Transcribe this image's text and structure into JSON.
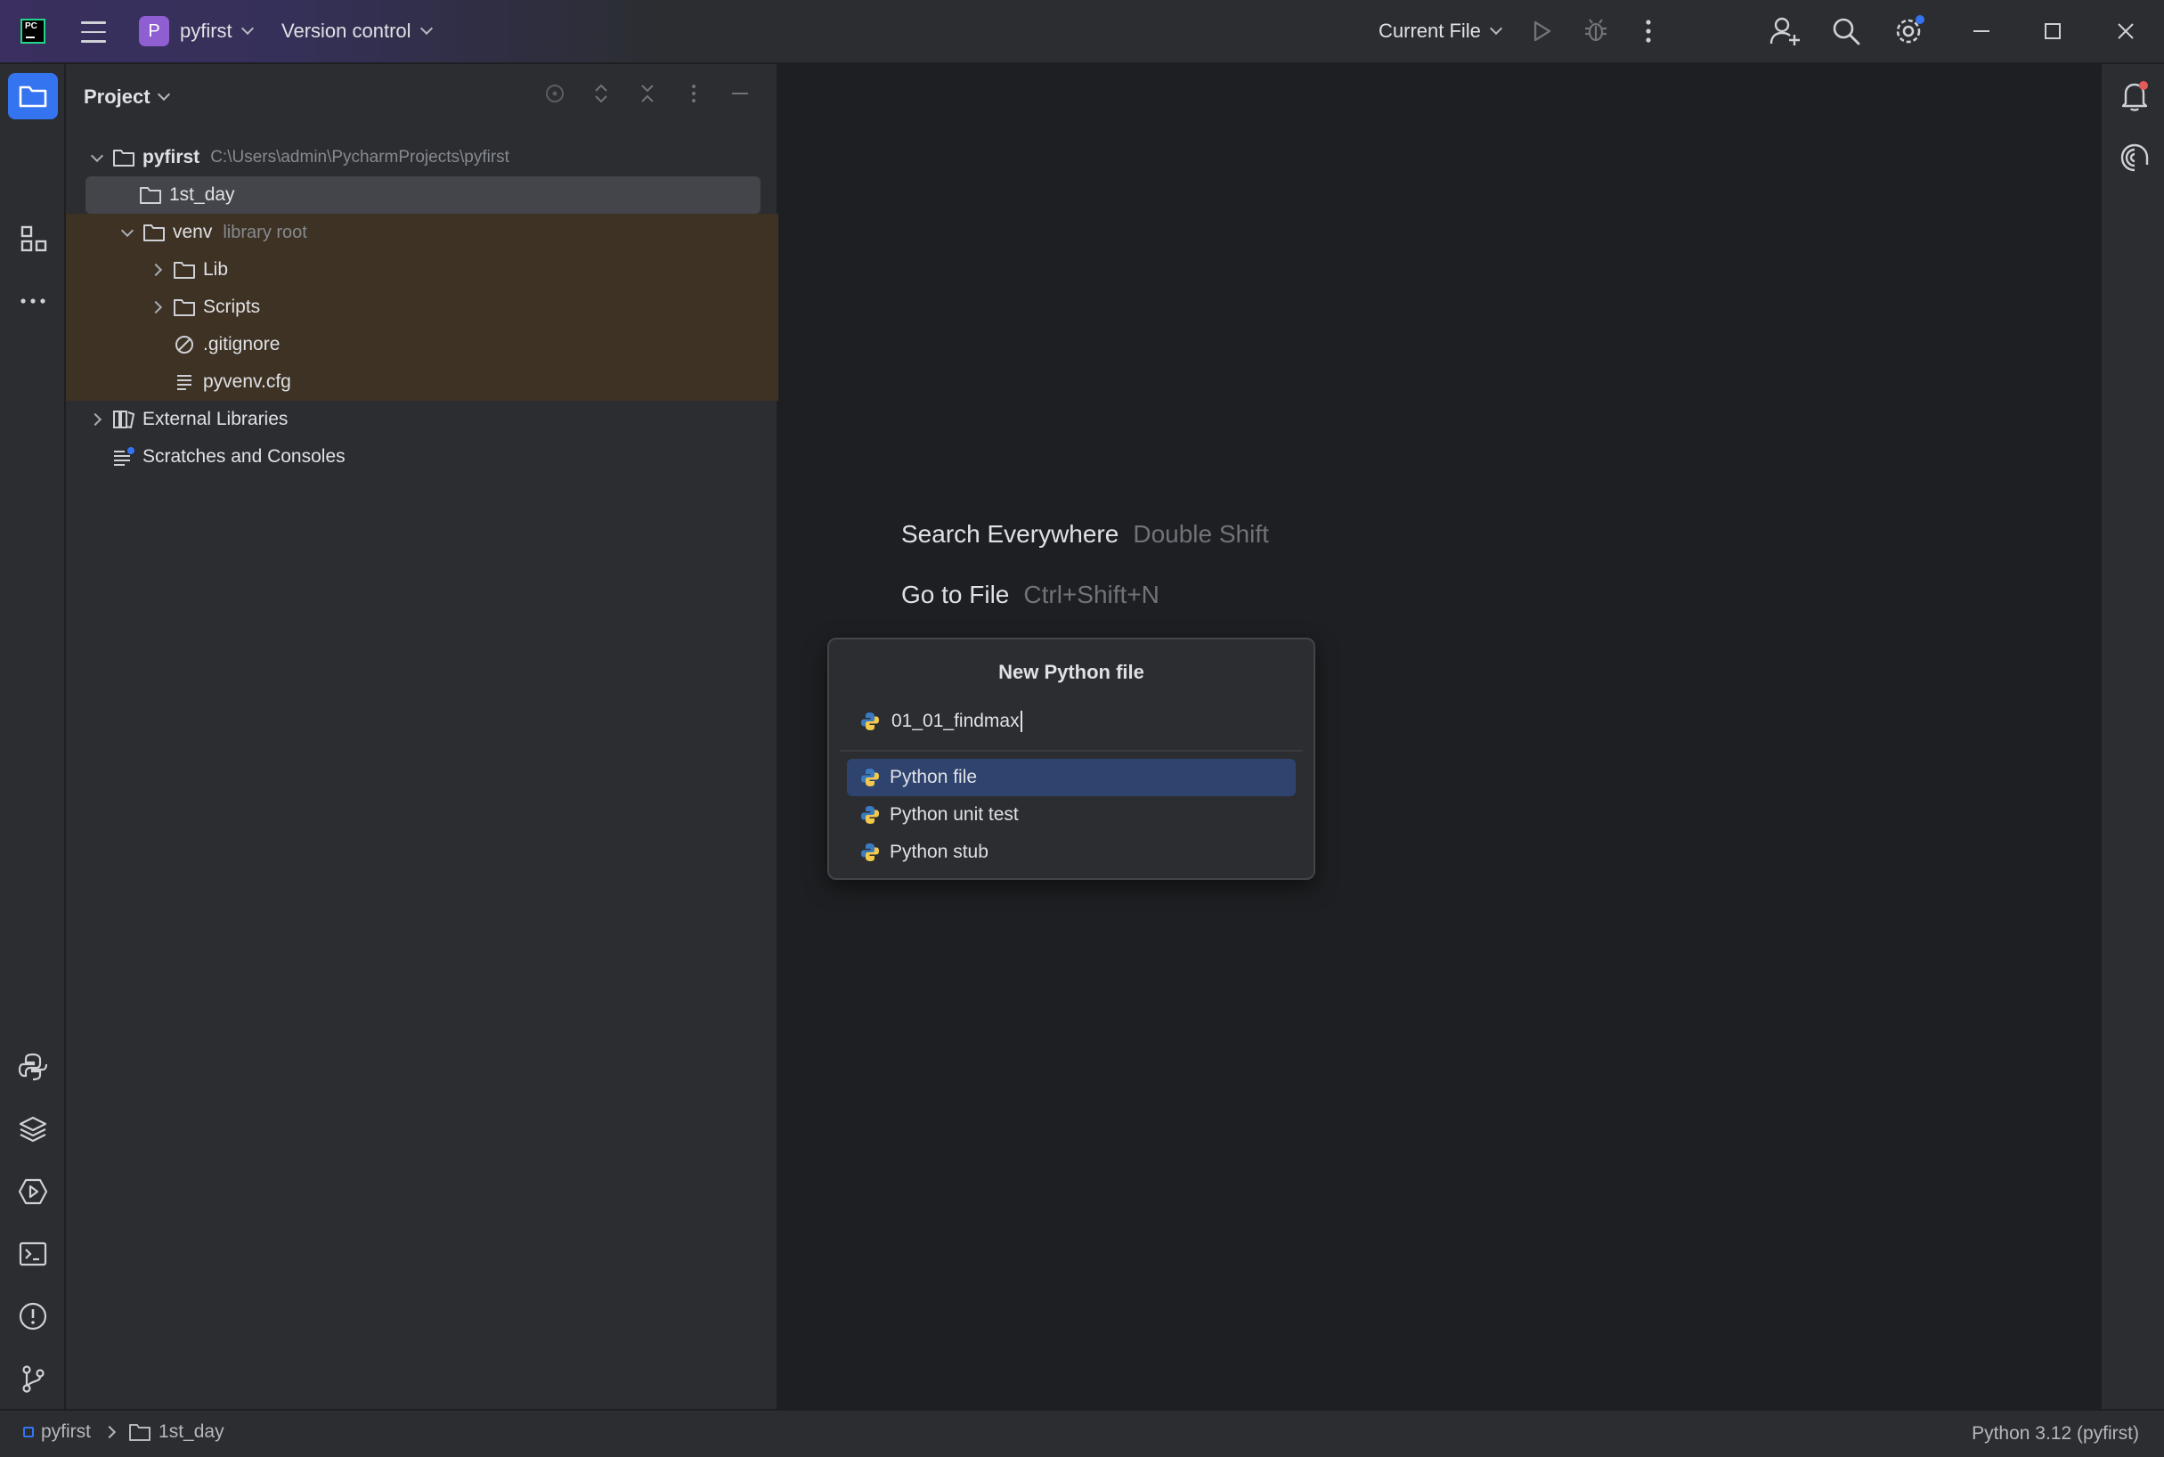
{
  "titlebar": {
    "project_badge": "P",
    "project_name": "pyfirst",
    "vcs_label": "Version control",
    "run_config": "Current File",
    "icons": [
      "app-logo",
      "hamburger-menu-icon",
      "run-icon",
      "debug-icon",
      "more-vertical-icon",
      "add-user-icon",
      "search-icon",
      "settings-icon",
      "minimize-icon",
      "maximize-icon",
      "close-icon"
    ]
  },
  "project_panel": {
    "title": "Project",
    "tree": {
      "root_name": "pyfirst",
      "root_path": "C:\\Users\\admin\\PycharmProjects\\pyfirst",
      "item_1st_day": "1st_day",
      "venv_name": "venv",
      "venv_hint": "library root",
      "lib": "Lib",
      "scripts": "Scripts",
      "gitignore": ".gitignore",
      "pyvenv": "pyvenv.cfg",
      "external_libraries": "External Libraries",
      "scratches": "Scratches and Consoles"
    }
  },
  "editor": {
    "hint1_label": "Search Everywhere",
    "hint1_shortcut": "Double Shift",
    "hint2_label": "Go to File",
    "hint2_shortcut": "Ctrl+Shift+N"
  },
  "popup": {
    "title": "New Python file",
    "input_value": "01_01_findmax",
    "options": [
      "Python file",
      "Python unit test",
      "Python stub"
    ],
    "selected_option": "Python file"
  },
  "statusbar": {
    "crumb_project": "pyfirst",
    "crumb_folder": "1st_day",
    "interpreter": "Python 3.12 (pyfirst)"
  },
  "colors": {
    "accent": "#3574f0",
    "background": "#1e1f22",
    "panel": "#2b2d30",
    "excluded_highlight": "#3d3223",
    "selection": "#2e436e",
    "project_badge": "#8f5ed1"
  }
}
